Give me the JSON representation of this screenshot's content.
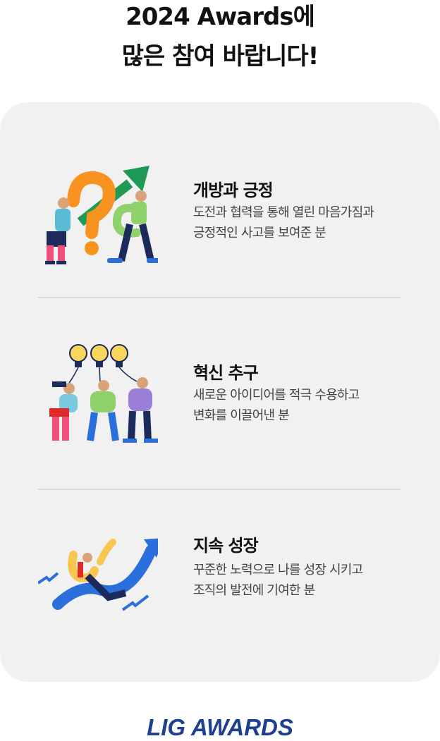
{
  "headline": {
    "line1": "2024 Awards에",
    "line2": "많은 참여 바랍니다!"
  },
  "items": [
    {
      "title": "개방과 긍정",
      "desc1": "도전과 협력을 통해 열린 마음가짐과",
      "desc2": "긍정적인 사고를 보여준 분",
      "illustration": "question-mark-people-illustration"
    },
    {
      "title": "혁신 추구",
      "desc1": "새로운 아이디어를 적극 수용하고",
      "desc2": "변화를 이끌어낸 분",
      "illustration": "lightbulb-ideas-illustration"
    },
    {
      "title": "지속 성장",
      "desc1": "꾸준한 노력으로 나를 성장 시키고",
      "desc2": "조직의 발전에 기여한 분",
      "illustration": "growth-arrow-illustration"
    }
  ],
  "logo": "LIG AWARDS",
  "colors": {
    "card_bg": "#f1f1f1",
    "logo": "#1f3f8f",
    "divider": "#dcdcdc"
  }
}
